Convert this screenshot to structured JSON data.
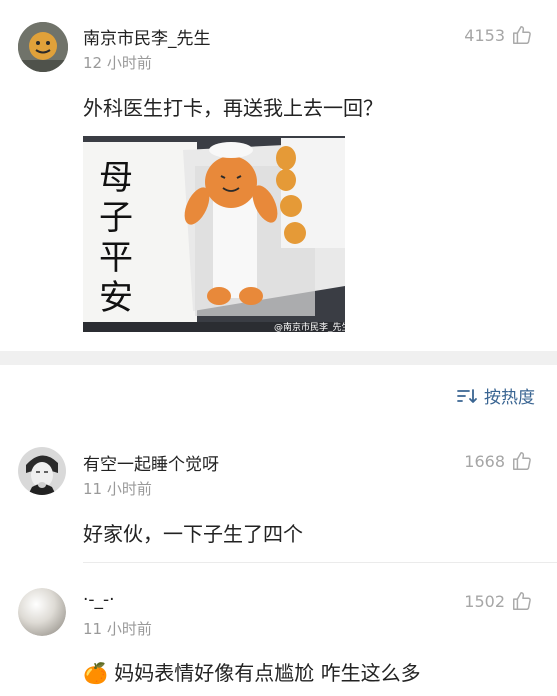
{
  "post": {
    "username": "南京市民李_先生",
    "time": "12 小时前",
    "likes": "4153",
    "content": "外科医生打卡，再送我上去一回？",
    "image": {
      "note_text": "母子平安",
      "watermark": "@南京市民李_先生"
    }
  },
  "sort": {
    "label": "按热度",
    "icon": "sort-icon"
  },
  "comments": [
    {
      "username": "有空一起睡个觉呀",
      "time": "11 小时前",
      "likes": "1668",
      "content": "好家伙，一下子生了四个"
    },
    {
      "username": "·-_-·",
      "time": "11 小时前",
      "likes": "1502",
      "emoji": "🍊",
      "content": "妈妈表情好像有点尴尬 咋生这么多"
    }
  ]
}
